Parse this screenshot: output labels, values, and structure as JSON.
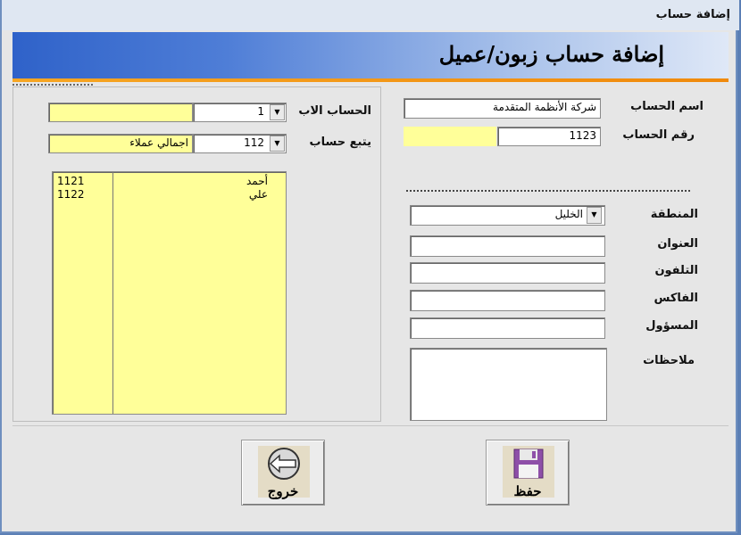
{
  "window": {
    "title": "إضافة حساب"
  },
  "header": {
    "title": "إضافة حساب زبون/عميل"
  },
  "form": {
    "account_name_label": "اسم الحساب",
    "account_name_value": "شركة الأنظمة المتقدمة",
    "account_number_label": "رقم الحساب",
    "account_number_value": "1123",
    "region_label": "المنطقة",
    "region_value": "الخليل",
    "address_label": "العنوان",
    "phone_label": "التلفون",
    "fax_label": "الفاكس",
    "responsible_label": "المسؤول",
    "notes_label": "ملاحظات"
  },
  "parent": {
    "parent_account_label": "الحساب الاب",
    "parent_account_value": "1",
    "follows_account_label": "يتبع حساب",
    "follows_account_value": "112",
    "follows_account_name": "اجمالي عملاء"
  },
  "list": {
    "rows": [
      {
        "number": "1121",
        "name": "أحمد"
      },
      {
        "number": "1122",
        "name": "علي"
      }
    ]
  },
  "buttons": {
    "exit_label": "خروج",
    "save_label": "حفظ"
  },
  "colors": {
    "header_blue": "#2f62c9",
    "accent_orange": "#f08a0c",
    "field_yellow": "#ffff99"
  }
}
